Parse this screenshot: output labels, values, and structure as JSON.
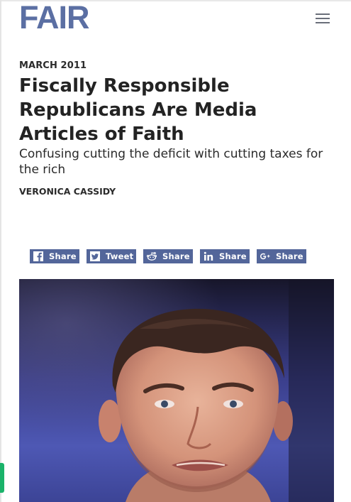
{
  "site": {
    "logo_text": "FAIR"
  },
  "article": {
    "date": "MARCH 2011",
    "title": "Fiscally Responsible Republicans Are Media Articles of Faith",
    "subtitle": "Confusing cutting the deficit with cutting taxes for the rich",
    "author": "VERONICA CASSIDY"
  },
  "share_buttons": [
    {
      "network": "facebook",
      "icon": "facebook-icon",
      "label": "Share"
    },
    {
      "network": "twitter",
      "icon": "twitter-icon",
      "label": "Tweet"
    },
    {
      "network": "reddit",
      "icon": "reddit-icon",
      "label": "Share"
    },
    {
      "network": "linkedin",
      "icon": "linkedin-icon",
      "label": "Share"
    },
    {
      "network": "google-plus",
      "icon": "google-plus-icon",
      "label": "Share"
    }
  ],
  "colors": {
    "brand_blue": "#5b6fa3",
    "share_bg": "#53669a",
    "side_tab_green": "#1bb36a"
  }
}
